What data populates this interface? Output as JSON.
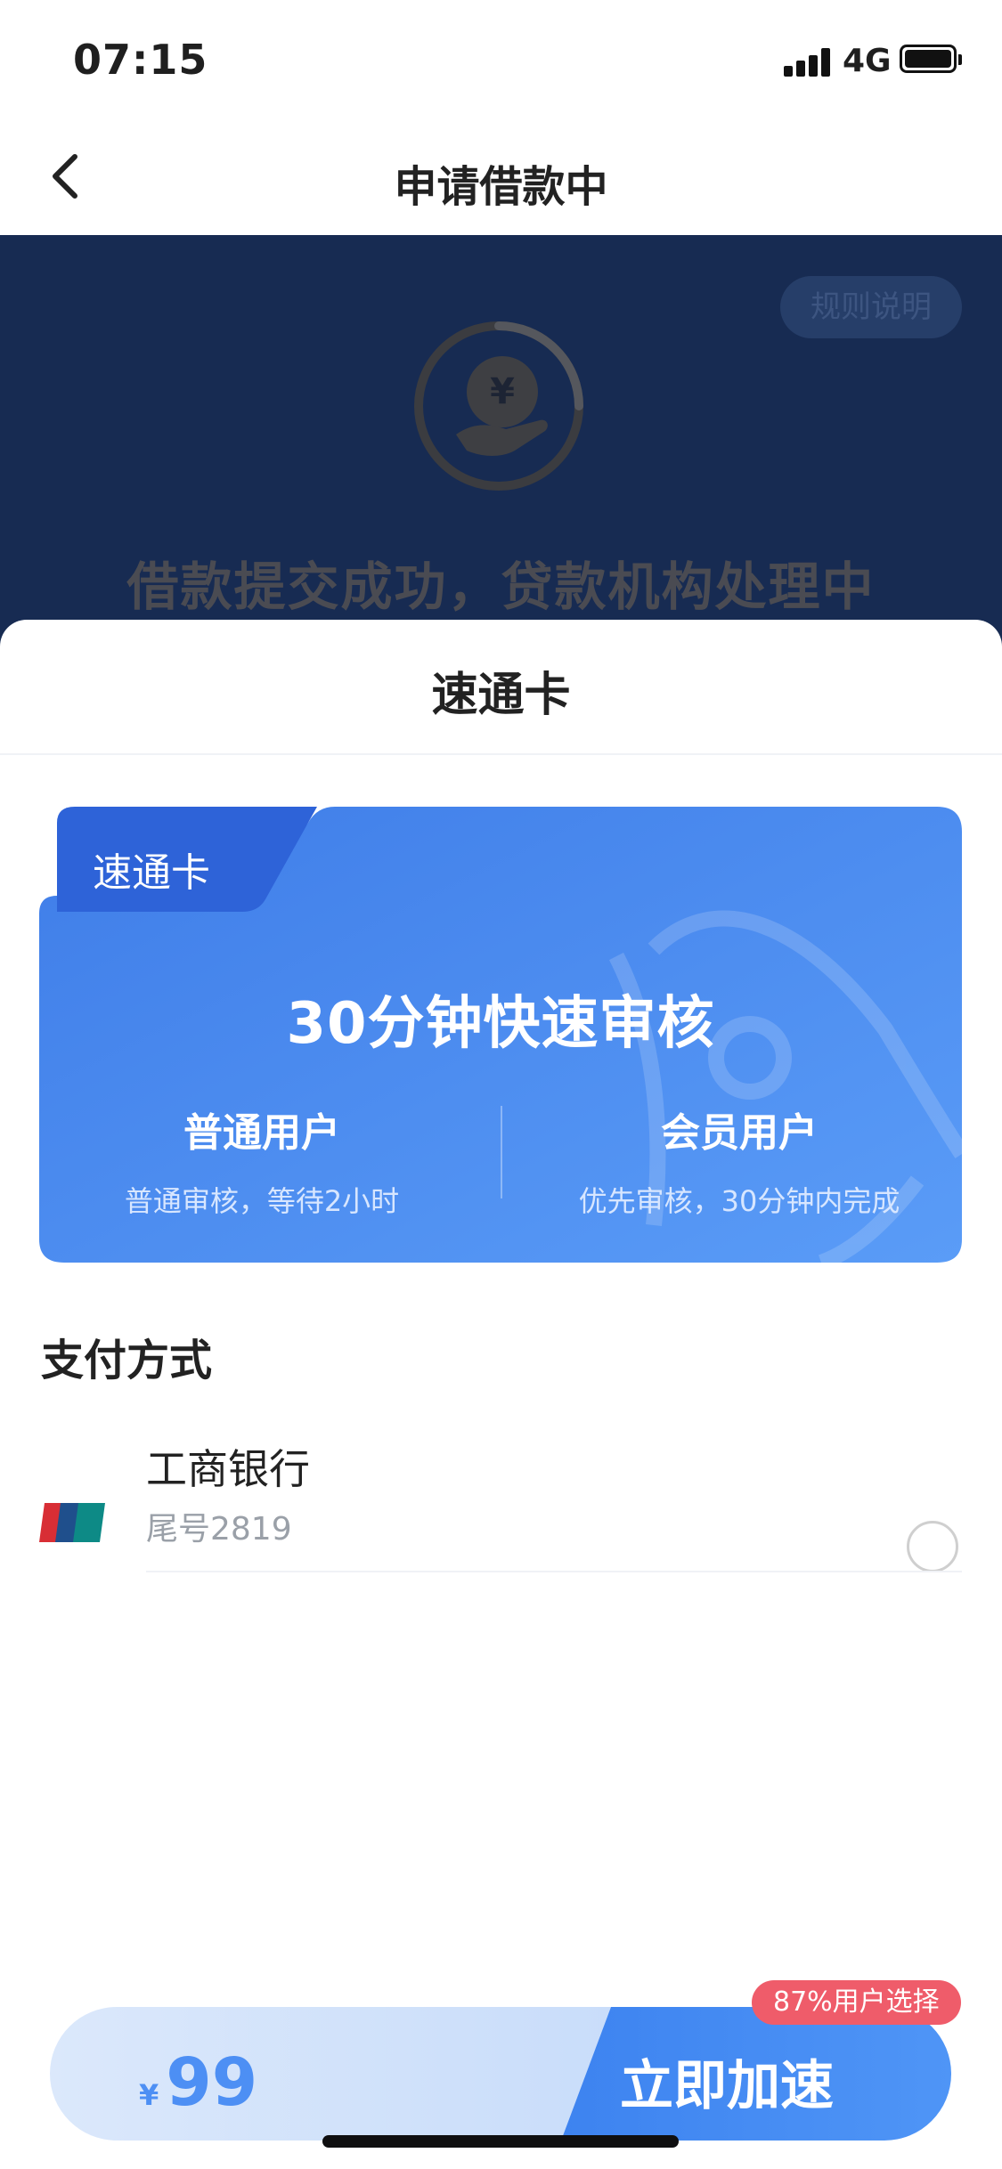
{
  "status_bar": {
    "time": "07:15",
    "network": "4G"
  },
  "nav": {
    "title": "申请借款中"
  },
  "background": {
    "rules_label": "规则说明",
    "status_text": "借款提交成功，贷款机构处理中"
  },
  "sheet": {
    "title": "速通卡"
  },
  "card": {
    "tag": "速通卡",
    "headline": "30分钟快速审核",
    "left": {
      "title": "普通用户",
      "desc": "普通审核，等待2小时"
    },
    "right": {
      "title": "会员用户",
      "desc": "优先审核，30分钟内完成"
    }
  },
  "payment": {
    "title": "支付方式",
    "items": [
      {
        "bank": "工商银行",
        "tail": "尾号2819",
        "icon": "unionpay-icon"
      }
    ]
  },
  "bottom": {
    "currency": "¥",
    "price": "99",
    "action": "立即加速",
    "badge": "87%用户选择"
  },
  "colors": {
    "accent_blue": "#4d8ff4",
    "dark_background": "#172b52",
    "badge": "#ef5c6a"
  }
}
